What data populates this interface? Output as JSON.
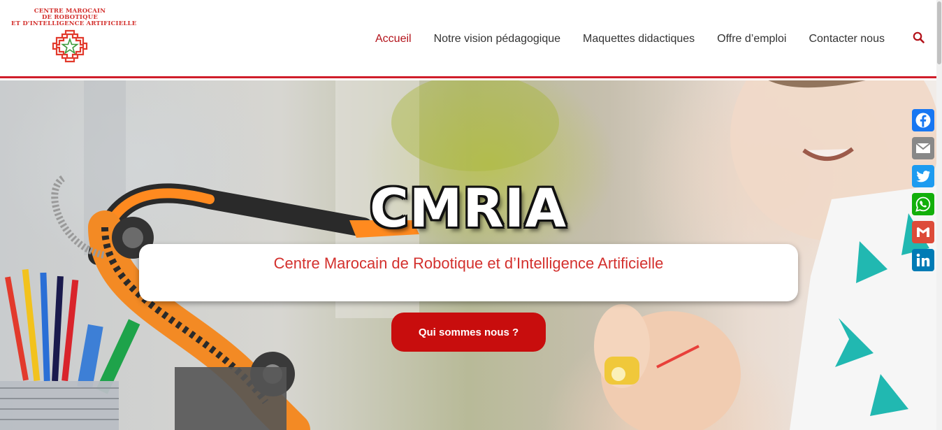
{
  "logo": {
    "lines": [
      "CENTRE MAROCAIN",
      "DE ROBOTIQUE",
      "ET D'INTELLIGENCE ARTIFICIELLE"
    ],
    "emblem_color": "#e23a2c",
    "star_color": "#3c9a3c"
  },
  "nav": {
    "items": [
      {
        "label": "Accueil",
        "active": true
      },
      {
        "label": "Notre vision pédagogique",
        "active": false
      },
      {
        "label": "Maquettes didactiques",
        "active": false
      },
      {
        "label": "Offre d’emploi",
        "active": false
      },
      {
        "label": "Contacter nous",
        "active": false
      }
    ],
    "search_icon": "search-icon"
  },
  "hero": {
    "title": "CMRIA",
    "subtitle": "Centre Marocain de Robotique et d’Intelligence Artificielle",
    "cta_label": "Qui sommes nous ?"
  },
  "share": {
    "buttons": [
      {
        "name": "facebook",
        "icon": "facebook-icon",
        "color": "#1877f2"
      },
      {
        "name": "email",
        "icon": "email-icon",
        "color": "#888888"
      },
      {
        "name": "twitter",
        "icon": "twitter-icon",
        "color": "#1d9bf0"
      },
      {
        "name": "whatsapp",
        "icon": "whatsapp-icon",
        "color": "#12af0a"
      },
      {
        "name": "gmail",
        "icon": "gmail-icon",
        "color": "#dd4b39"
      },
      {
        "name": "linkedin",
        "icon": "linkedin-icon",
        "color": "#007bb5"
      }
    ]
  },
  "colors": {
    "accent": "#d01e2b",
    "cta": "#c80d0d",
    "subtitle": "#d3302d",
    "nav_active": "#b3121a",
    "nav_text": "#333333"
  }
}
